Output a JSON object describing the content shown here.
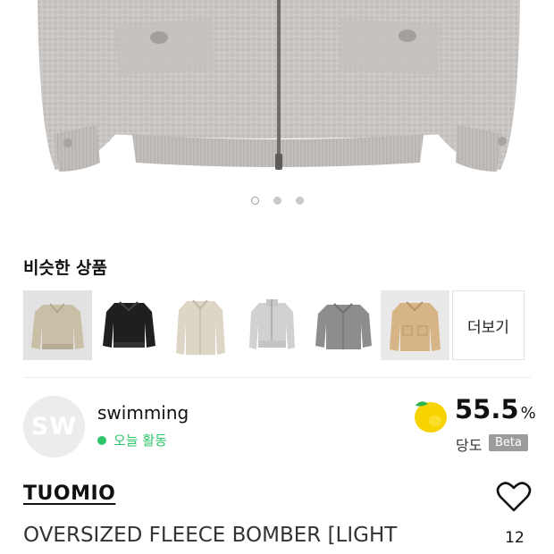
{
  "gallery": {
    "image_icon": "jacket-photo",
    "dots_total": 3,
    "active_index": 0
  },
  "similar": {
    "title": "비슷한 상품",
    "more_label": "더보기",
    "items": [
      {
        "icon": "beige-bomber-jacket",
        "color": "#c9bfa7"
      },
      {
        "icon": "black-bomber-jacket",
        "color": "#1f1f1f"
      },
      {
        "icon": "cream-zip-jacket",
        "color": "#ddd5c6"
      },
      {
        "icon": "grey-zip-jacket",
        "color": "#cfd2cf"
      },
      {
        "icon": "grey-collar-jacket",
        "color": "#8c8d8f"
      },
      {
        "icon": "tan-work-jacket",
        "color": "#d6b486"
      }
    ]
  },
  "seller": {
    "initials": "SW",
    "name": "swimming",
    "status": "오늘 활동",
    "status_color": "#2fc46a"
  },
  "sweetness": {
    "value": "55.5",
    "unit": "%",
    "label": "당도",
    "badge": "Beta",
    "icon": "lemon-icon"
  },
  "product": {
    "brand": "TUOMIO",
    "title": "OVERSIZED FLEECE BOMBER [LIGHT",
    "likes": "12"
  }
}
